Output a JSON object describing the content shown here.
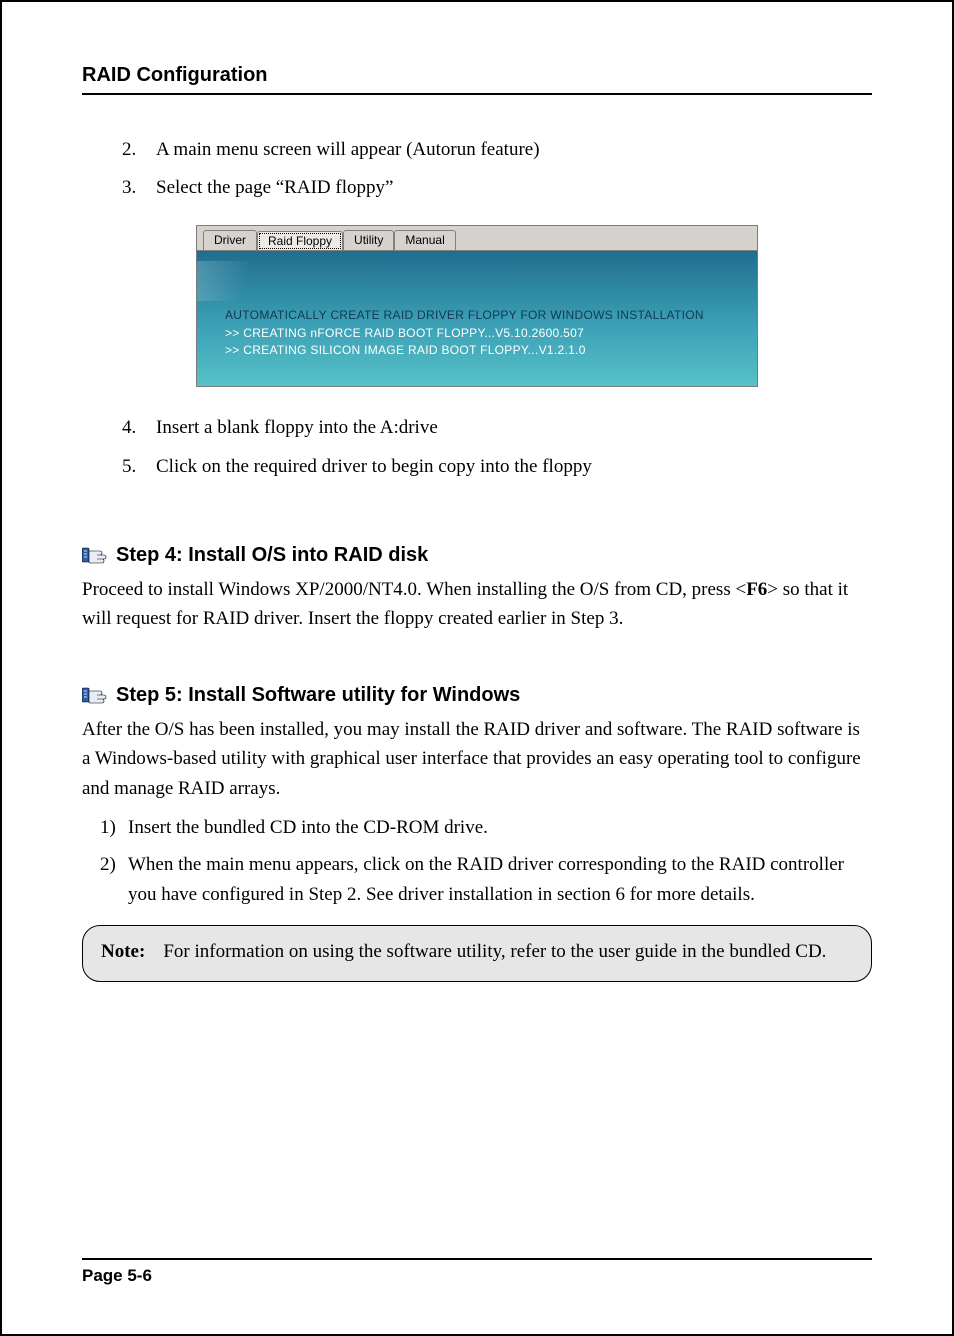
{
  "page": {
    "header_title": "RAID Configuration",
    "footer": "Page 5-6"
  },
  "list_top": {
    "items": [
      {
        "num": "2.",
        "text": "A main menu screen will appear (Autorun feature)"
      },
      {
        "num": "3.",
        "text": "Select the page “RAID floppy”"
      }
    ]
  },
  "screenshot": {
    "tabs": [
      {
        "label": "Driver",
        "active": false
      },
      {
        "label": "Raid Floppy",
        "active": true
      },
      {
        "label": "Utility",
        "active": false
      },
      {
        "label": "Manual",
        "active": false
      }
    ],
    "heading": "AUTOMATICALLY CREATE RAID DRIVER FLOPPY FOR WINDOWS INSTALLATION",
    "lines": [
      ">> CREATING nFORCE RAID BOOT FLOPPY...V5.10.2600.507",
      ">> CREATING SILICON IMAGE RAID BOOT FLOPPY...V1.2.1.0"
    ]
  },
  "list_bottom": {
    "items": [
      {
        "num": "4.",
        "text": "Insert a blank floppy into the A:drive"
      },
      {
        "num": "5.",
        "text": "Click on the required driver to begin copy into the floppy"
      }
    ]
  },
  "step4": {
    "title": "Step 4: Install O/S into RAID disk",
    "text_pre": "Proceed to install Windows XP/2000/NT4.0.  When installing the O/S from CD, press <",
    "text_key": "F6",
    "text_post": "> so that it will request for RAID driver. Insert the floppy created earlier in Step 3."
  },
  "step5": {
    "title": "Step 5: Install Software utility for Windows",
    "text": "After the O/S has been installed, you may install the RAID driver and software. The RAID software is a Windows-based utility with graphical user interface that provides an easy operating tool to configure and manage RAID arrays.",
    "items": [
      {
        "pn": "1)",
        "text": "Insert the bundled CD into the CD-ROM drive."
      },
      {
        "pn": "2)",
        "text": "When the main menu appears, click on the RAID driver corresponding to the RAID controller you have configured in Step 2.  See driver installation in section 6 for more details."
      }
    ]
  },
  "note": {
    "label": "Note:",
    "text": "For information on using the software utility, refer to the user guide in the bundled CD."
  }
}
